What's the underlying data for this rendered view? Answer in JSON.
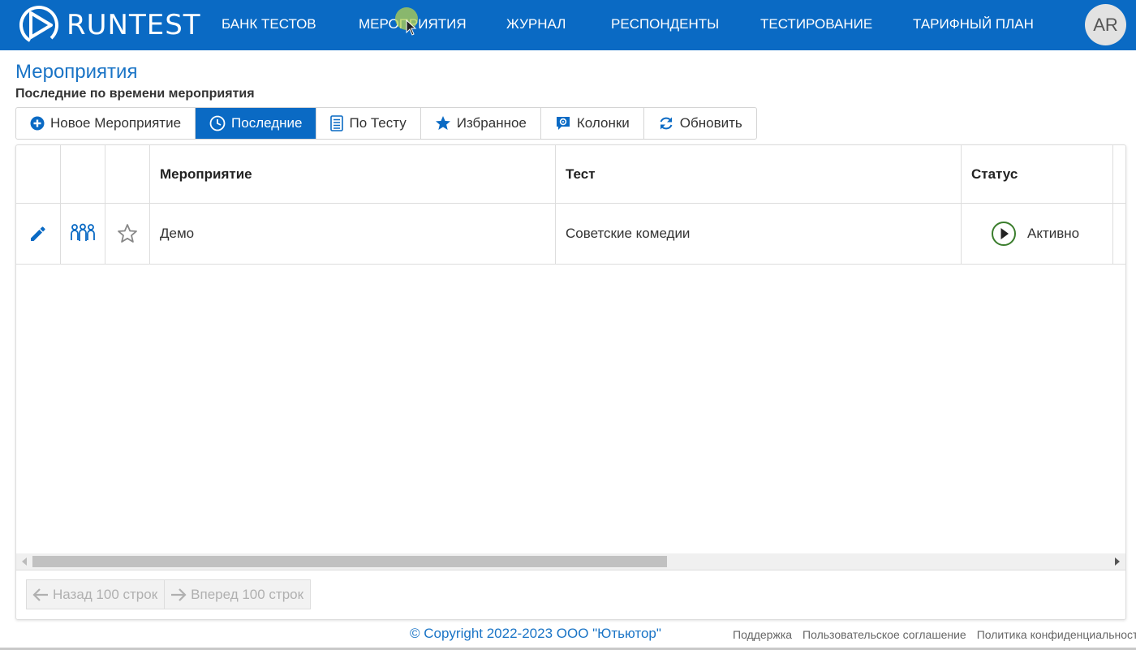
{
  "brand": {
    "name": "RUNTEST",
    "accent": "#0a6ac4"
  },
  "nav": {
    "items": [
      {
        "label": "БАНК ТЕСТОВ"
      },
      {
        "label": "МЕРОПРИЯТИЯ"
      },
      {
        "label": "ЖУРНАЛ"
      },
      {
        "label": "РЕСПОНДЕНТЫ"
      },
      {
        "label": "ТЕСТИРОВАНИЕ"
      },
      {
        "label": "ТАРИФНЫЙ ПЛАН"
      }
    ],
    "avatar": "AR"
  },
  "page": {
    "title": "Мероприятия",
    "subtitle": "Последние по времени мероприятия"
  },
  "toolbar": {
    "buttons": [
      {
        "label": "Новое Мероприятие",
        "icon": "plus-circle-icon"
      },
      {
        "label": "Последние",
        "icon": "clock-icon",
        "active": true
      },
      {
        "label": "По Тесту",
        "icon": "document-list-icon"
      },
      {
        "label": "Избранное",
        "icon": "star-icon"
      },
      {
        "label": "Колонки",
        "icon": "gear-comment-icon"
      },
      {
        "label": "Обновить",
        "icon": "refresh-icon"
      }
    ]
  },
  "table": {
    "columns": [
      "",
      "",
      "",
      "Мероприятие",
      "Тест",
      "Статус"
    ],
    "rows": [
      {
        "icons": [
          "edit-icon",
          "group-icon",
          "star-outline-icon"
        ],
        "event": "Демо",
        "test": "Советские комедии",
        "status": "Активно",
        "status_icon": "play-circle-icon"
      }
    ]
  },
  "pager": {
    "prev": "Назад 100 строк",
    "next": "Вперед 100 строк"
  },
  "footer": {
    "copyright": "© Copyright 2022-2023 ООО \"Ютьютор\"",
    "links": [
      "Поддержка",
      "Пользовательское соглашение",
      "Политика конфиденциальности"
    ]
  }
}
